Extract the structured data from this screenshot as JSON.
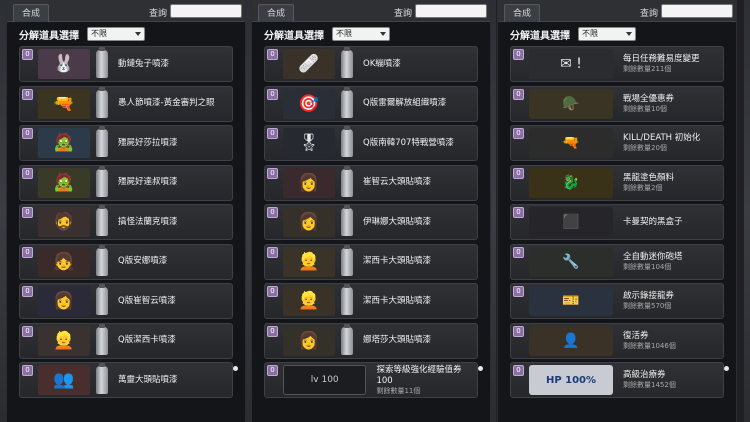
{
  "panels": [
    {
      "tab": "合成",
      "search_label": "查詢",
      "search_value": "",
      "filter_label": "分解道具選擇",
      "filter_value": "不限",
      "items": [
        {
          "badge": "0",
          "name": "動鏈兔子噴漆",
          "sub": "",
          "icon": "🐰",
          "bg": "#4a3a4a"
        },
        {
          "badge": "0",
          "name": "愚人節噴漆-黃金審判之眼",
          "sub": "",
          "icon": "🔫",
          "bg": "#3a3420"
        },
        {
          "badge": "0",
          "name": "殭屍好莎拉噴漆",
          "sub": "",
          "icon": "🧟",
          "bg": "#2c3a4a"
        },
        {
          "badge": "0",
          "name": "殭屍好達叔噴漆",
          "sub": "",
          "icon": "🧟",
          "bg": "#3a3a28"
        },
        {
          "badge": "0",
          "name": "搞怪法蘭克噴漆",
          "sub": "",
          "icon": "🧔",
          "bg": "#3a3030"
        },
        {
          "badge": "0",
          "name": "Q版安娜噴漆",
          "sub": "",
          "icon": "👧",
          "bg": "#3a2a2a"
        },
        {
          "badge": "0",
          "name": "Q版崔智云噴漆",
          "sub": "",
          "icon": "👩",
          "bg": "#2a2a38"
        },
        {
          "badge": "0",
          "name": "Q版潔西卡噴漆",
          "sub": "",
          "icon": "👱",
          "bg": "#3a3230"
        },
        {
          "badge": "0",
          "name": "萬靈大頭貼噴漆",
          "sub": "",
          "icon": "👥",
          "bg": "#4a2e2e"
        }
      ]
    },
    {
      "tab": "合成",
      "search_label": "查詢",
      "search_value": "",
      "filter_label": "分解道具選擇",
      "filter_value": "不限",
      "items": [
        {
          "badge": "0",
          "name": "OK繃噴漆",
          "sub": "",
          "icon": "🩹",
          "bg": "#3a3228"
        },
        {
          "badge": "0",
          "name": "Q版雷爾解放組織噴漆",
          "sub": "",
          "icon": "🎯",
          "bg": "#2a2e36"
        },
        {
          "badge": "0",
          "name": "Q版南韓707特戰營噴漆",
          "sub": "",
          "icon": "🎖",
          "bg": "#262a30"
        },
        {
          "badge": "0",
          "name": "崔智云大頭貼噴漆",
          "sub": "",
          "icon": "👩",
          "bg": "#3a2a2e"
        },
        {
          "badge": "0",
          "name": "伊琳娜大頭貼噴漆",
          "sub": "",
          "icon": "👩",
          "bg": "#36302a"
        },
        {
          "badge": "0",
          "name": "潔西卡大頭貼噴漆",
          "sub": "",
          "icon": "👱",
          "bg": "#3a3428"
        },
        {
          "badge": "0",
          "name": "潔西卡大頭貼噴漆",
          "sub": "",
          "icon": "👱",
          "bg": "#3a3226"
        },
        {
          "badge": "0",
          "name": "娜塔莎大頭貼噴漆",
          "sub": "",
          "icon": "👩",
          "bg": "#34302a"
        },
        {
          "badge": "0",
          "name": "探索等級強化經驗值券100",
          "sub": "剩餘數量11個",
          "icon": "lv 100",
          "bg": "#1c1d20"
        }
      ]
    },
    {
      "tab": "合成",
      "search_label": "查詢",
      "search_value": "",
      "filter_label": "分解道具選擇",
      "filter_value": "不限",
      "items": [
        {
          "badge": "0",
          "name": "每日任務難易度變更",
          "sub": "剩餘數量211個",
          "icon": "✉ !",
          "bg": "#2a2c30"
        },
        {
          "badge": "0",
          "name": "戰場全優惠券",
          "sub": "剩餘數量10個",
          "icon": "🪖",
          "bg": "#3a3424"
        },
        {
          "badge": "0",
          "name": "KILL/DEATH 初始化",
          "sub": "剩餘數量20個",
          "icon": "🔫",
          "bg": "#2c2c2c"
        },
        {
          "badge": "0",
          "name": "黑龍塗色顏料",
          "sub": "剩餘數量2個",
          "icon": "🐉",
          "bg": "#3a3218"
        },
        {
          "badge": "0",
          "name": "卡曼契的黑盒子",
          "sub": "",
          "icon": "⬛",
          "bg": "#26262a"
        },
        {
          "badge": "0",
          "name": "全自動迷你砲塔",
          "sub": "剩餘數量104個",
          "icon": "🔧",
          "bg": "#2c2e2c"
        },
        {
          "badge": "0",
          "name": "啟示錄接龍券",
          "sub": "剩餘數量570個",
          "icon": "🎫",
          "bg": "#2a3240"
        },
        {
          "badge": "0",
          "name": "復活券",
          "sub": "剩餘數量1046個",
          "icon": "👤",
          "bg": "#3a3226"
        },
        {
          "badge": "0",
          "name": "高級治療券",
          "sub": "剩餘數量1452個",
          "icon": "HP 100%",
          "bg": "#2c2e34"
        }
      ]
    }
  ]
}
